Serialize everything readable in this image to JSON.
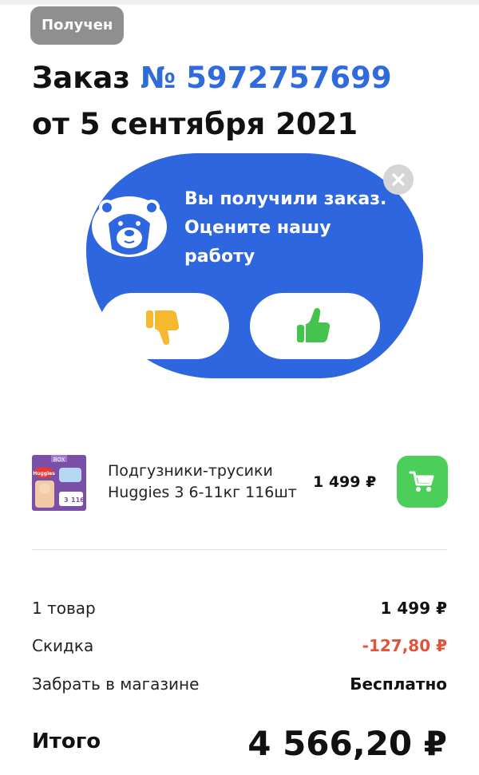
{
  "status": "Получен",
  "order": {
    "prefix": "Заказ",
    "number": "№ 5972757699",
    "date": "от 5 сентября 2021"
  },
  "rating": {
    "message": "Вы получили заказ. Оцените нашу работу",
    "dislike_icon": "thumbs-down-icon",
    "like_icon": "thumbs-up-icon",
    "close_icon": "close-icon",
    "colors": {
      "card": "#2d66df",
      "dislike": "#f5b82e",
      "like": "#46c34f"
    }
  },
  "product": {
    "image_brand": "Huggies",
    "image_box_label": "BOX",
    "image_size": "3",
    "image_count": "116",
    "name": "Подгузники-трусики Huggies 3 6-11кг 116шт",
    "price": "1 499 ₽",
    "cart_icon": "cart-icon",
    "cart_color": "#4ccf5a"
  },
  "summary": {
    "items_label": "1 товар",
    "items_value": "1 499 ₽",
    "discount_label": "Скидка",
    "discount_value": "-127,80 ₽",
    "delivery_label": "Забрать в магазине",
    "delivery_value": "Бесплатно",
    "total_label": "Итого",
    "total_value": "4 566,20 ₽"
  }
}
